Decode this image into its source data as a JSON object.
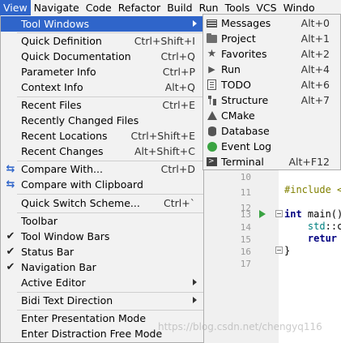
{
  "menubar": {
    "items": [
      "View",
      "Navigate",
      "Code",
      "Refactor",
      "Build",
      "Run",
      "Tools",
      "VCS",
      "Windo"
    ]
  },
  "view_menu": {
    "items": [
      {
        "label": "Tool Windows",
        "shortcut": "",
        "submenu": true,
        "highlighted": true
      },
      {
        "label": "Quick Definition",
        "shortcut": "Ctrl+Shift+I"
      },
      {
        "label": "Quick Documentation",
        "shortcut": "Ctrl+Q"
      },
      {
        "label": "Parameter Info",
        "shortcut": "Ctrl+P"
      },
      {
        "label": "Context Info",
        "shortcut": "Alt+Q"
      },
      {
        "label": "Recent Files",
        "shortcut": "Ctrl+E"
      },
      {
        "label": "Recently Changed Files",
        "shortcut": ""
      },
      {
        "label": "Recent Locations",
        "shortcut": "Ctrl+Shift+E"
      },
      {
        "label": "Recent Changes",
        "shortcut": "Alt+Shift+C"
      },
      {
        "label": "Compare With...",
        "shortcut": "Ctrl+D"
      },
      {
        "label": "Compare with Clipboard",
        "shortcut": ""
      },
      {
        "label": "Quick Switch Scheme...",
        "shortcut": "Ctrl+`"
      },
      {
        "label": "Toolbar",
        "shortcut": ""
      },
      {
        "label": "Tool Window Bars",
        "shortcut": "",
        "checked": true
      },
      {
        "label": "Status Bar",
        "shortcut": "",
        "checked": true
      },
      {
        "label": "Navigation Bar",
        "shortcut": "",
        "checked": true
      },
      {
        "label": "Active Editor",
        "shortcut": "",
        "submenu": true
      },
      {
        "label": "Bidi Text Direction",
        "shortcut": "",
        "submenu": true
      },
      {
        "label": "Enter Presentation Mode",
        "shortcut": ""
      },
      {
        "label": "Enter Distraction Free Mode",
        "shortcut": ""
      }
    ]
  },
  "tool_windows_submenu": {
    "items": [
      {
        "label": "Messages",
        "shortcut": "Alt+0",
        "icon": "messages-icon"
      },
      {
        "label": "Project",
        "shortcut": "Alt+1",
        "icon": "folder-icon"
      },
      {
        "label": "Favorites",
        "shortcut": "Alt+2",
        "icon": "star-icon"
      },
      {
        "label": "Run",
        "shortcut": "Alt+4",
        "icon": "run-icon"
      },
      {
        "label": "TODO",
        "shortcut": "Alt+6",
        "icon": "todo-icon"
      },
      {
        "label": "Structure",
        "shortcut": "Alt+7",
        "icon": "structure-icon"
      },
      {
        "label": "CMake",
        "shortcut": "",
        "icon": "cmake-icon"
      },
      {
        "label": "Database",
        "shortcut": "",
        "icon": "database-icon"
      },
      {
        "label": "Event Log",
        "shortcut": "",
        "icon": "event-log-icon"
      },
      {
        "label": "Terminal",
        "shortcut": "Alt+F12",
        "icon": "terminal-icon"
      }
    ]
  },
  "editor": {
    "line_numbers": [
      "10",
      "11",
      "12",
      "13",
      "14",
      "15",
      "16",
      "17"
    ],
    "code_include_kw": "#include <",
    "code_int": "int",
    "code_main": " main()",
    "code_std": "std",
    "code_std_rest": "::c",
    "code_return": "retur",
    "code_close": "}"
  },
  "watermark": "https://blog.csdn.net/chengyq116"
}
